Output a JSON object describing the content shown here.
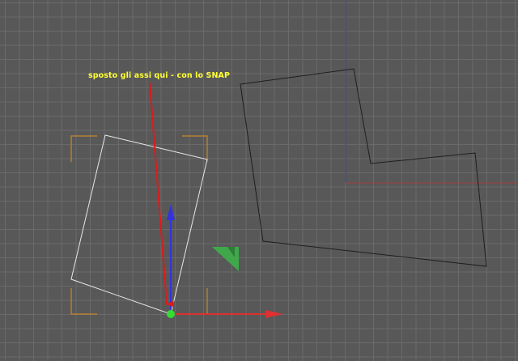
{
  "annotation": {
    "text": "sposto gli assi qui - con lo SNAP"
  },
  "colors": {
    "background": "#585858",
    "grid": "#6a6a6a",
    "world_axis_y": "#3a3aa8",
    "world_axis_x": "#a04040",
    "annotation_text": "#ffff33",
    "arrow": "#e01a1a",
    "selected_polygon": "#e8e8e8",
    "bounding_brackets": "#c8882a",
    "gizmo_x": "#e03030",
    "gizmo_y": "#3333dd",
    "gizmo_plane": "#3fa84a",
    "gizmo_origin": "#33dd33",
    "polygon": "#1e1e1e"
  },
  "icons": {
    "pivot": "green-dot",
    "gizmo_x": "red-arrow",
    "gizmo_y": "blue-arrow",
    "gizmo_plane": "green-triangle"
  }
}
